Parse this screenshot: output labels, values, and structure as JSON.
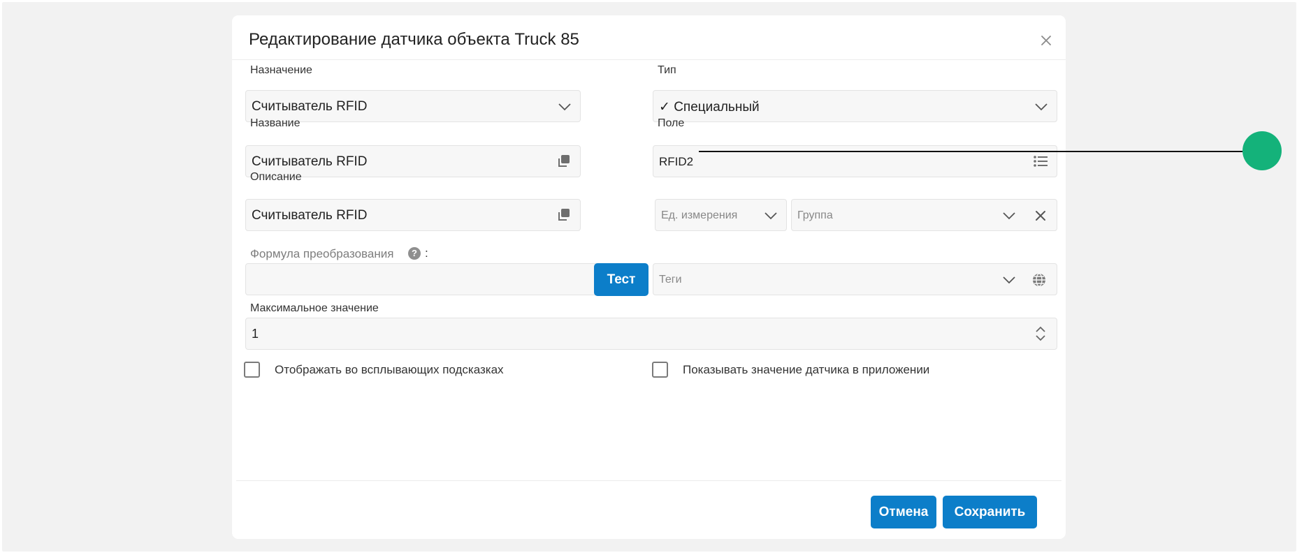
{
  "dialog": {
    "title": "Редактирование датчика объекта Truck 85"
  },
  "form": {
    "purpose": {
      "label": "Назначение",
      "value": "Считыватель RFID"
    },
    "type": {
      "label": "Тип",
      "value": "✓ Специальный"
    },
    "name": {
      "label": "Название",
      "value": "Считыватель RFID"
    },
    "field": {
      "label": "Поле",
      "value": "RFID2"
    },
    "description": {
      "label": "Описание",
      "value": "Считыватель RFID"
    },
    "unit": {
      "placeholder": "Ед. измерения"
    },
    "group": {
      "placeholder": "Группа"
    },
    "formula": {
      "label": "Формула преобразования",
      "help": "?",
      "colon": ":",
      "value": "",
      "test_label": "Тест"
    },
    "tags": {
      "placeholder": "Теги"
    },
    "max_value": {
      "label": "Максимальное значение",
      "value": "1"
    },
    "show_in_tooltips": {
      "label": "Отображать во всплывающих подсказках",
      "checked": false
    },
    "show_in_app": {
      "label": "Показывать значение датчика в приложении",
      "checked": false
    }
  },
  "footer": {
    "cancel_label": "Отмена",
    "save_label": "Сохранить"
  },
  "icons": {
    "close": "close-icon",
    "chevron": "chevron-down-icon",
    "copy": "copy-icon",
    "list": "list-icon",
    "clear": "clear-icon",
    "globe": "globe-icon",
    "spinner": "stepper-icon"
  },
  "colors": {
    "accent": "#0c7ec9",
    "marker": "#14b27a",
    "backdrop": "#f2f2f2"
  }
}
